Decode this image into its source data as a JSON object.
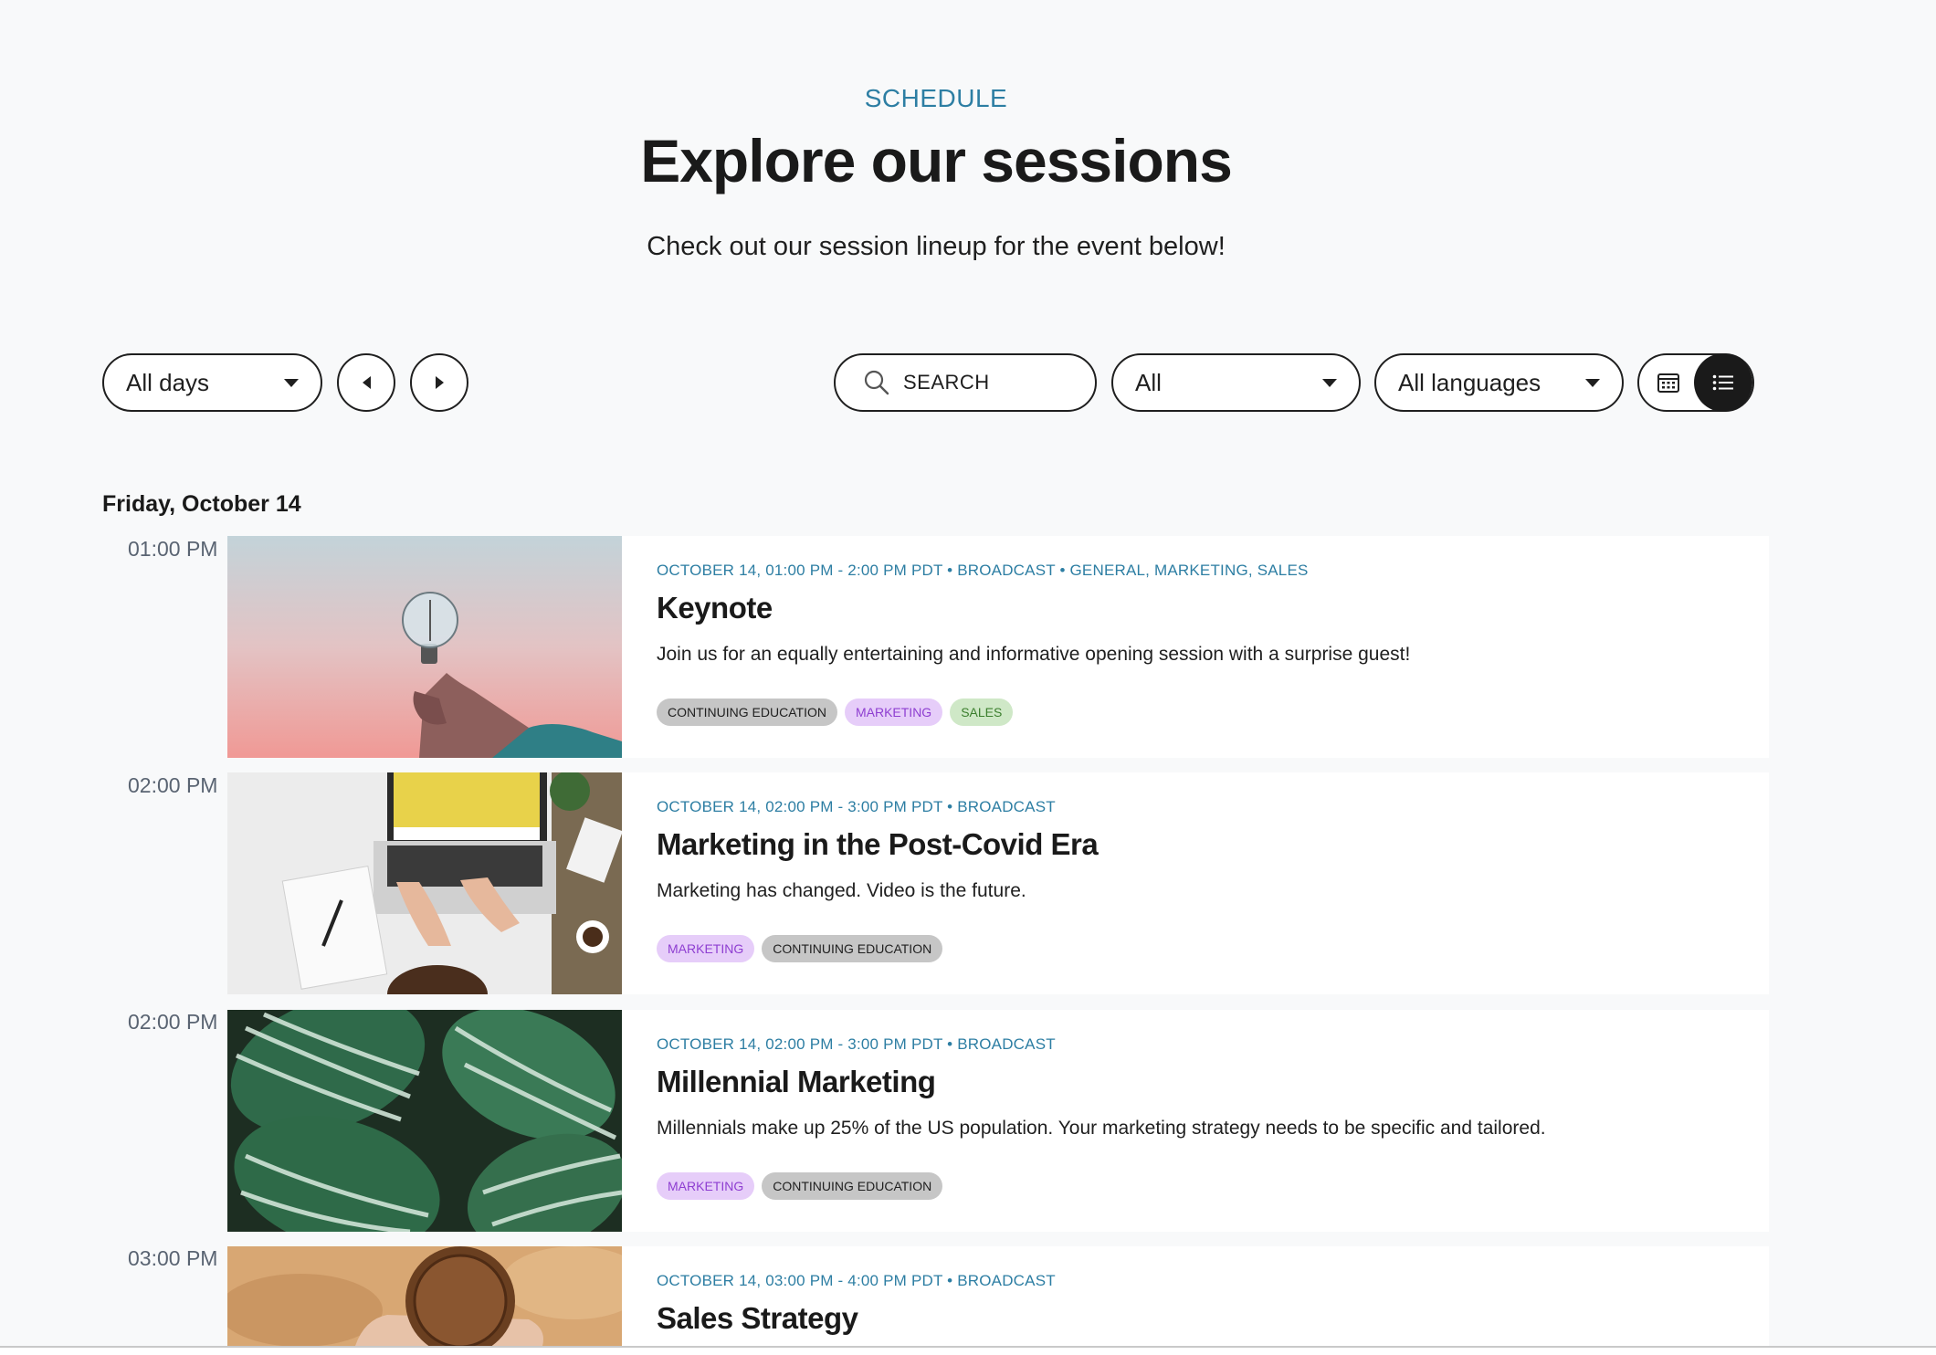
{
  "header": {
    "eyebrow": "SCHEDULE",
    "title": "Explore our sessions",
    "subtitle": "Check out our session lineup for the event below!"
  },
  "toolbar": {
    "day_select": "All days",
    "search_placeholder": "SEARCH",
    "category_select": "All",
    "language_select": "All languages",
    "active_view": "list"
  },
  "schedule": {
    "date_heading": "Friday, October 14",
    "sessions": [
      {
        "time": "01:00 PM",
        "meta": "OCTOBER 14, 01:00 PM - 2:00 PM PDT • BROADCAST • GENERAL, MARKETING, SALES",
        "title": "Keynote",
        "description": "Join us for an equally entertaining and informative opening session with a surprise guest!",
        "tags": [
          "CONTINUING EDUCATION",
          "MARKETING",
          "SALES"
        ]
      },
      {
        "time": "02:00 PM",
        "meta": "OCTOBER 14, 02:00 PM - 3:00 PM PDT • BROADCAST",
        "title": "Marketing in the Post-Covid Era",
        "description": "Marketing has changed. Video is the future.",
        "tags": [
          "MARKETING",
          "CONTINUING EDUCATION"
        ]
      },
      {
        "time": "02:00 PM",
        "meta": "OCTOBER 14, 02:00 PM - 3:00 PM PDT • BROADCAST",
        "title": "Millennial Marketing",
        "description": "Millennials make up 25% of the US population. Your marketing strategy needs to be specific and tailored.",
        "tags": [
          "MARKETING",
          "CONTINUING EDUCATION"
        ]
      },
      {
        "time": "03:00 PM",
        "meta": "OCTOBER 14, 03:00 PM - 4:00 PM PDT • BROADCAST",
        "title": "Sales Strategy"
      }
    ]
  },
  "colors": {
    "accent": "#2d7ea3",
    "background": "#f8f9fa",
    "tag_continuing_education": "#c6c6c6",
    "tag_marketing": "#e6cdf9",
    "tag_sales": "#cfe8c7"
  }
}
